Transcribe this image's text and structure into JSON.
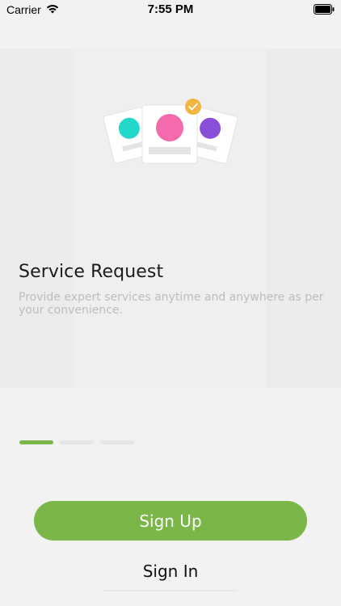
{
  "status_bar": {
    "carrier": "Carrier",
    "time": "7:55 PM",
    "wifi_icon": "wifi-icon",
    "battery_icon": "battery-icon"
  },
  "slide": {
    "title": "Service Request",
    "description": "Provide expert services anytime and anywhere as per your convenience.",
    "illustration_icon": "service-cards-illustration"
  },
  "pager": {
    "count": 3,
    "active_index": 0
  },
  "actions": {
    "sign_up_label": "Sign Up",
    "sign_in_label": "Sign In"
  },
  "colors": {
    "accent": "#7ab648",
    "background": "#f2f2f2",
    "teal": "#22d8c8",
    "pink": "#f46aac",
    "purple": "#8a4fd8",
    "check": "#f2b544"
  }
}
